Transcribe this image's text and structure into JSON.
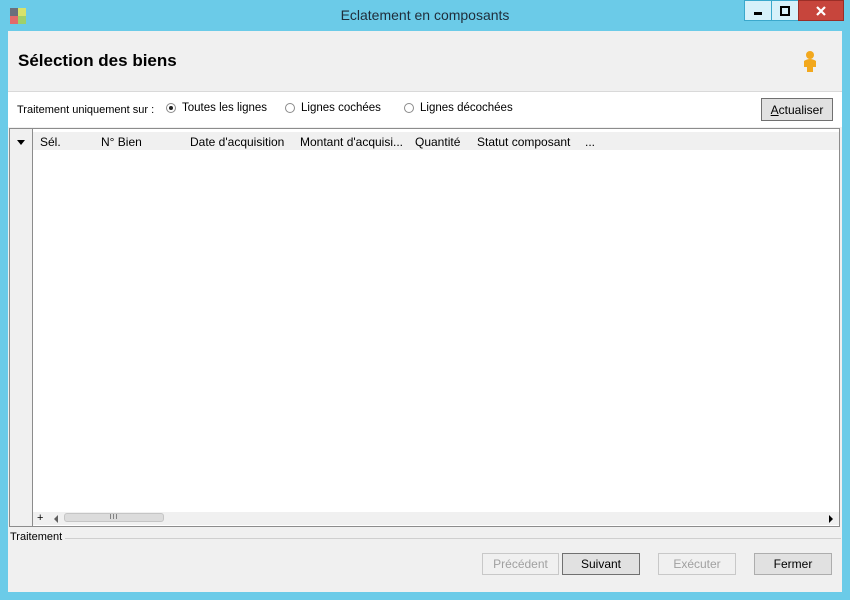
{
  "window": {
    "title": "Eclatement en composants",
    "icons": {
      "app": "app-icon",
      "minimize": "minimize-icon",
      "maximize": "maximize-icon",
      "close": "close-icon"
    }
  },
  "header": {
    "title": "Sélection des biens",
    "icon": "user-icon"
  },
  "filter": {
    "label": "Traitement uniquement sur :",
    "options": [
      {
        "label": "Toutes les lignes",
        "selected": true
      },
      {
        "label": "Lignes cochées",
        "selected": false
      },
      {
        "label": "Lignes décochées",
        "selected": false
      }
    ],
    "refresh_button": {
      "label": "Actualiser",
      "mnemonic_letter": "A",
      "rest": "ctualiser"
    }
  },
  "grid": {
    "columns": [
      "Sél.",
      "N° Bien",
      "Date d'acquisition",
      "Montant d'acquisi...",
      "Quantité",
      "Statut composant",
      "..."
    ],
    "rows": [],
    "add_label": "+",
    "scroll_grip": "III"
  },
  "footer": {
    "group_label": "Traitement",
    "buttons": [
      {
        "label": "Précédent",
        "enabled": false
      },
      {
        "label": "Suivant",
        "enabled": true
      },
      {
        "label": "Exécuter",
        "enabled": false
      },
      {
        "label": "Fermer",
        "enabled": true
      }
    ]
  },
  "colors": {
    "title_bar": "#6bcbe8",
    "close_button": "#c7453c",
    "client": "#f0f0f0"
  }
}
